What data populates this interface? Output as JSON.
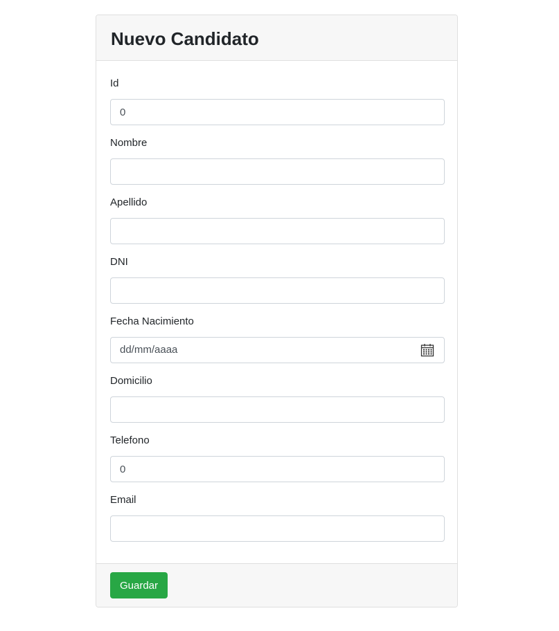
{
  "form": {
    "title": "Nuevo Candidato",
    "fields": [
      {
        "label": "Id",
        "value": "0"
      },
      {
        "label": "Nombre",
        "value": ""
      },
      {
        "label": "Apellido",
        "value": ""
      },
      {
        "label": "DNI",
        "value": ""
      },
      {
        "label": "Fecha Nacimiento",
        "placeholder": "dd/mm/aaaa",
        "icon": "calendar-icon"
      },
      {
        "label": "Domicilio",
        "value": ""
      },
      {
        "label": "Telefono",
        "value": "0"
      },
      {
        "label": "Email",
        "value": ""
      }
    ],
    "save_label": "Guardar"
  },
  "colors": {
    "header_bg": "#f7f7f7",
    "border": "#dfdfdf",
    "input_border": "#ced4da",
    "save_button": "#28a745"
  }
}
